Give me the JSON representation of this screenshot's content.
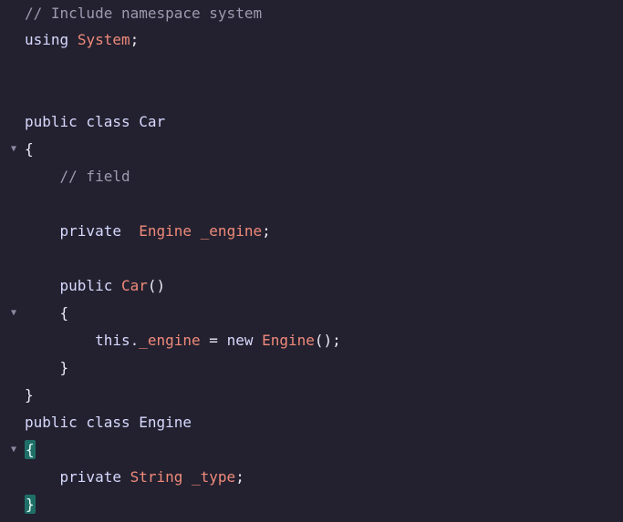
{
  "theme": {
    "background": "#23212f",
    "comment_color": "#9c9aaf",
    "keyword_color": "#d7d9ff",
    "type_color": "#f08a7b",
    "text_color": "#ececf6",
    "brace_highlight": "#1f6f68"
  },
  "code": {
    "lines": [
      {
        "tokens": [
          {
            "t": "// Include namespace system",
            "k": "comment"
          }
        ]
      },
      {
        "tokens": [
          {
            "t": "using",
            "k": "kw"
          },
          {
            "t": " ",
            "k": "plain"
          },
          {
            "t": "System",
            "k": "type"
          },
          {
            "t": ";",
            "k": "punc"
          }
        ]
      },
      {
        "tokens": []
      },
      {
        "tokens": []
      },
      {
        "tokens": [
          {
            "t": "public class Car",
            "k": "kw"
          }
        ]
      },
      {
        "fold": "▼",
        "tokens": [
          {
            "t": "{",
            "k": "punc"
          }
        ]
      },
      {
        "tokens": [
          {
            "t": "    ",
            "k": "plain"
          },
          {
            "t": "// field",
            "k": "comment"
          }
        ]
      },
      {
        "tokens": []
      },
      {
        "tokens": [
          {
            "t": "    private  ",
            "k": "kw"
          },
          {
            "t": "Engine _engine",
            "k": "type"
          },
          {
            "t": ";",
            "k": "punc"
          }
        ]
      },
      {
        "tokens": []
      },
      {
        "tokens": [
          {
            "t": "    public ",
            "k": "kw"
          },
          {
            "t": "Car",
            "k": "type"
          },
          {
            "t": "()",
            "k": "punc"
          }
        ]
      },
      {
        "fold": "▼",
        "tokens": [
          {
            "t": "    {",
            "k": "punc"
          }
        ]
      },
      {
        "tokens": [
          {
            "t": "        this.",
            "k": "kw"
          },
          {
            "t": "_engine",
            "k": "type"
          },
          {
            "t": " = ",
            "k": "plain"
          },
          {
            "t": "new ",
            "k": "kw"
          },
          {
            "t": "Engine",
            "k": "type"
          },
          {
            "t": "();",
            "k": "punc"
          }
        ]
      },
      {
        "tokens": [
          {
            "t": "    }",
            "k": "punc"
          }
        ]
      },
      {
        "tokens": [
          {
            "t": "}",
            "k": "punc"
          }
        ]
      },
      {
        "tokens": [
          {
            "t": "public class Engine",
            "k": "kw"
          }
        ]
      },
      {
        "fold": "▼",
        "tokens": [
          {
            "t": "{",
            "k": "brace-hl"
          }
        ]
      },
      {
        "tokens": [
          {
            "t": "    private ",
            "k": "kw"
          },
          {
            "t": "String _type",
            "k": "type"
          },
          {
            "t": ";",
            "k": "punc"
          }
        ]
      },
      {
        "tokens": [
          {
            "t": "}",
            "k": "brace-hl"
          }
        ]
      }
    ]
  }
}
